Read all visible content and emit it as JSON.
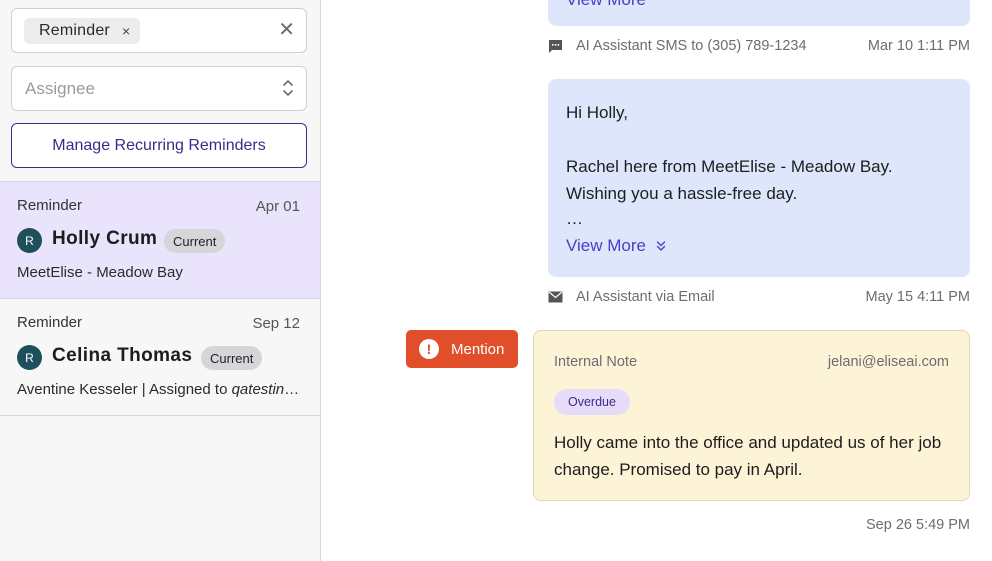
{
  "filters": {
    "chip_label": "Reminder",
    "chip_remove": "×",
    "clear": "✕",
    "assignee_placeholder": "Assignee",
    "manage_label": "Manage Recurring Reminders"
  },
  "list": [
    {
      "type": "Reminder",
      "date": "Apr 01",
      "avatar": "R",
      "name": "Holly Crum",
      "badge": "Current",
      "subtitle": "MeetElise - Meadow Bay",
      "selected": true
    },
    {
      "type": "Reminder",
      "date": "Sep 12",
      "avatar": "R",
      "name": "Celina Thomas",
      "badge": "Current",
      "subtitle_prefix": "Aventine Kesseler | Assigned to ",
      "subtitle_italic": "qatesting…",
      "selected": false
    }
  ],
  "conversation": {
    "top_view_more": "View More",
    "sms_meta": "AI Assistant SMS to (305) 789-1234",
    "sms_time": "Mar 10 1:11 PM",
    "message_lines": [
      "Hi Holly,",
      "Rachel here from MeetElise - Meadow Bay.",
      "Wishing you a hassle-free day.",
      "…"
    ],
    "view_more": "View More",
    "email_meta": "AI Assistant via Email",
    "email_time": "May 15 4:11 PM",
    "mention_label": "Mention",
    "mention_icon": "!",
    "note": {
      "label": "Internal Note",
      "author": "jelani@eliseai.com",
      "status": "Overdue",
      "text": "Holly came into the office and updated us of her job change. Promised to pay in April."
    },
    "note_time": "Sep 26 5:49 PM"
  },
  "colors": {
    "accent": "#3b2c8a",
    "link": "#4a3fc9",
    "mention": "#e04e2a",
    "selected_row": "#e9e3fb",
    "message_bubble": "#dde6fb",
    "note_bg": "#fdf3d6"
  }
}
